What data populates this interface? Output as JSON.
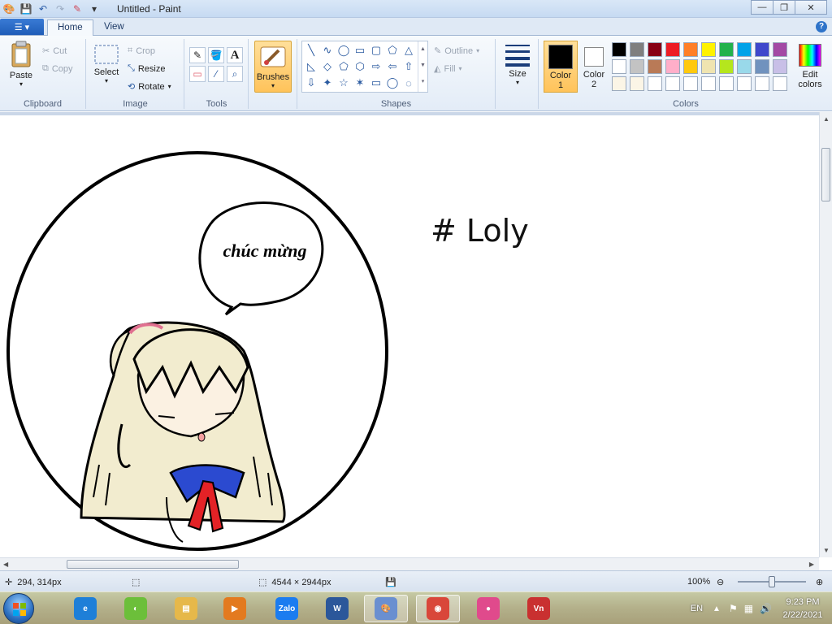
{
  "window": {
    "title": "Untitled - Paint",
    "minimize_icon": "—",
    "restore_icon": "❐",
    "close_icon": "✕"
  },
  "qat": {
    "paint_icon": "🎨",
    "save_icon": "💾",
    "undo_icon": "↶",
    "redo_icon": "↷",
    "eraser_icon": "✎",
    "dropdown_icon": "▾"
  },
  "ribbon_tabs": {
    "file_label": "☰ ▾",
    "home": "Home",
    "view": "View",
    "help": "?"
  },
  "clipboard": {
    "paste": "Paste",
    "cut": "Cut",
    "copy": "Copy",
    "group_label": "Clipboard"
  },
  "image": {
    "select": "Select",
    "crop": "Crop",
    "resize": "Resize",
    "rotate": "Rotate",
    "group_label": "Image"
  },
  "tools": {
    "group_label": "Tools",
    "pencil": "✎",
    "fill": "🪣",
    "text": "A",
    "eraser": "▭",
    "picker": "⁄",
    "magnifier": "⌕"
  },
  "brushes": {
    "label": "Brushes"
  },
  "shapes": {
    "outline": "Outline",
    "fill": "Fill",
    "group_label": "Shapes",
    "glyphs": [
      "╲",
      "∿",
      "◯",
      "▭",
      "▢",
      "⬠",
      "△",
      "◺",
      "◇",
      "⬠",
      "⬡",
      "⇨",
      "⇦",
      "⇧",
      "⇩",
      "✦",
      "☆",
      "✶",
      "▭",
      "◯",
      "◌"
    ]
  },
  "size": {
    "label": "Size"
  },
  "colors": {
    "color1_label_line1": "Color",
    "color1_label_line2": "1",
    "color2_label_line1": "Color",
    "color2_label_line2": "2",
    "edit_line1": "Edit",
    "edit_line2": "colors",
    "group_label": "Colors",
    "color1": "#000000",
    "color2": "#ffffff",
    "palette_row1": [
      "#000000",
      "#7f7f7f",
      "#880015",
      "#ed1c24",
      "#ff7f27",
      "#fff200",
      "#22b14c",
      "#00a2e8",
      "#3f48cc",
      "#a349a4"
    ],
    "palette_row2": [
      "#ffffff",
      "#c3c3c3",
      "#b97a57",
      "#ffaec9",
      "#ffc90e",
      "#efe4b0",
      "#b5e61d",
      "#99d9ea",
      "#7092be",
      "#c8bfe7"
    ],
    "palette_row3": [
      "#fbf5e6",
      "#fbf5e6",
      "#ffffff",
      "#ffffff",
      "#ffffff",
      "#ffffff",
      "#ffffff",
      "#ffffff",
      "#ffffff",
      "#ffffff"
    ]
  },
  "canvas": {
    "speech_text": "chúc mừng",
    "hashtag_text": "# Loly"
  },
  "status": {
    "cursor_pos": "294, 314px",
    "image_size": "4544 × 2944px",
    "zoom": "100%"
  },
  "taskbar": {
    "apps": [
      {
        "name": "internet-explorer",
        "label": "e",
        "color": "#1e7fd8"
      },
      {
        "name": "coccoc",
        "label": "◐",
        "color": "#6cbf3a"
      },
      {
        "name": "file-explorer",
        "label": "▤",
        "color": "#e6b84a"
      },
      {
        "name": "media-player",
        "label": "▶",
        "color": "#e37a1f"
      },
      {
        "name": "zalo",
        "label": "Zalo",
        "color": "#1b7cf0"
      },
      {
        "name": "word",
        "label": "W",
        "color": "#2b579a"
      },
      {
        "name": "paint",
        "label": "🎨",
        "color": "#6a8fd0"
      },
      {
        "name": "chrome",
        "label": "◉",
        "color": "#d9473a"
      },
      {
        "name": "color-app",
        "label": "●",
        "color": "#e04a8c"
      },
      {
        "name": "unikey",
        "label": "Vn",
        "color": "#c93030"
      }
    ],
    "lang": "EN",
    "time": "9:23 PM",
    "date": "2/22/2021"
  }
}
